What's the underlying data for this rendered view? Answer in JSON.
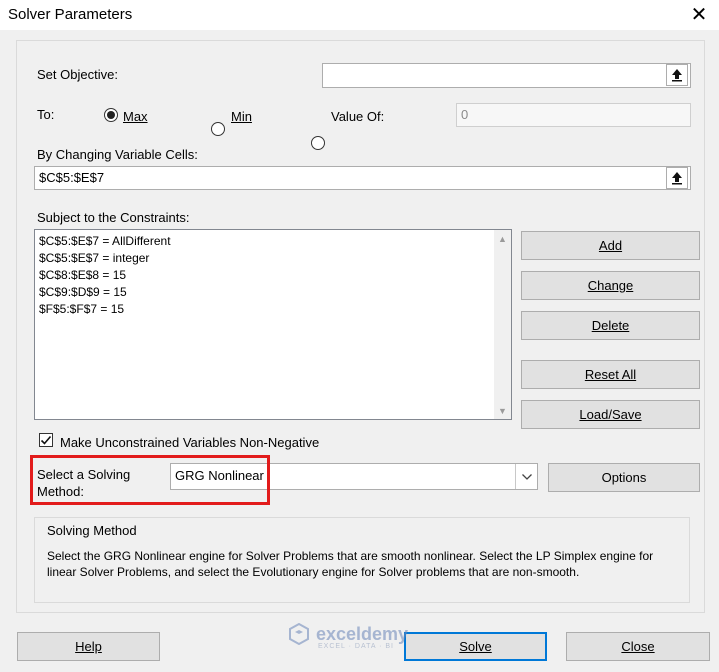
{
  "window": {
    "title": "Solver Parameters",
    "close_glyph": "✕"
  },
  "objective": {
    "label": "Set Objective:",
    "value": ""
  },
  "to": {
    "label": "To:",
    "options": [
      {
        "label": "Max",
        "selected": true
      },
      {
        "label": "Min",
        "selected": false
      },
      {
        "label": "Value Of:",
        "selected": false
      }
    ],
    "value_of": "0"
  },
  "changing": {
    "label": "By Changing Variable Cells:",
    "value": "$C$5:$E$7"
  },
  "constraints": {
    "label": "Subject to the Constraints:",
    "items": [
      "$C$5:$E$7 = AllDifferent",
      "$C$5:$E$7 = integer",
      "$C$8:$E$8 = 15",
      "$C$9:$D$9 = 15",
      "$F$5:$F$7 = 15"
    ]
  },
  "buttons": {
    "add": "Add",
    "change": "Change",
    "delete": "Delete",
    "reset_all": "Reset All",
    "load_save": "Load/Save",
    "options": "Options",
    "help": "Help",
    "solve": "Solve",
    "close": "Close"
  },
  "nonneg": {
    "label": "Make Unconstrained Variables Non-Negative",
    "checked": true
  },
  "method": {
    "label_line1": "Select a Solving",
    "label_line2": "Method:",
    "selected": "GRG Nonlinear",
    "highlight_color": "#e21b1b"
  },
  "solving_method": {
    "title": "Solving Method",
    "description": "Select the GRG Nonlinear engine for Solver Problems that are smooth nonlinear. Select the LP Simplex engine for linear Solver Problems, and select the Evolutionary engine for Solver problems that are non-smooth."
  },
  "watermark": {
    "name": "exceldemy",
    "tagline": "EXCEL · DATA · BI"
  },
  "colors": {
    "accent": "#0078d7",
    "highlight": "#e21b1b"
  }
}
